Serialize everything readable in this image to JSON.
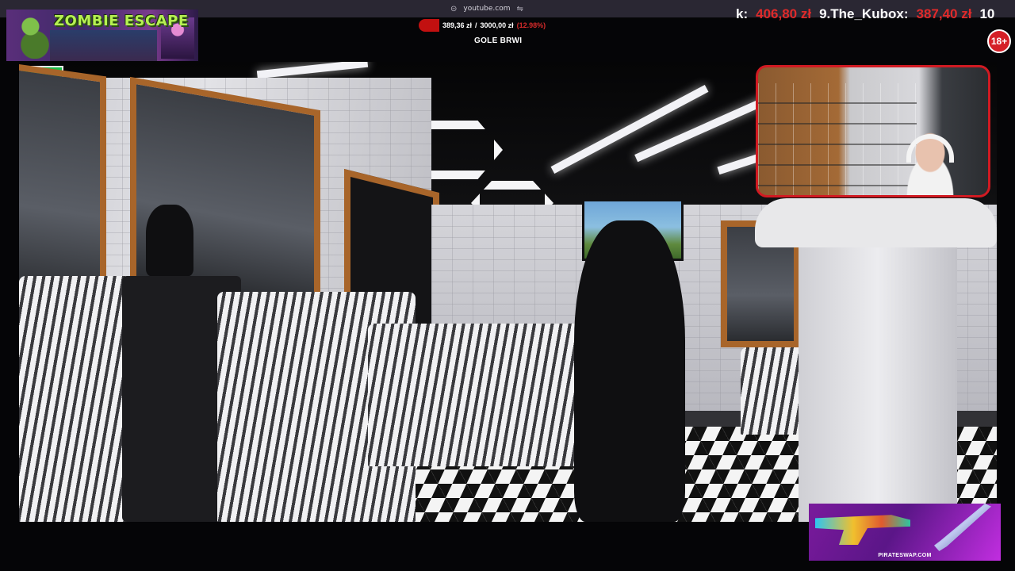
{
  "browser": {
    "url": "youtube.com",
    "left_icon": "link-icon",
    "right_icon": "settings-sliders-icon"
  },
  "ticker": {
    "segments": [
      {
        "name": "k:",
        "amount": "406,80 zł"
      },
      {
        "name": "9.The_Kubox:",
        "amount": "387,40 zł"
      },
      {
        "name": "10",
        "amount": ""
      }
    ]
  },
  "age_badge": "18+",
  "game_banner": {
    "title": "ZOMBIE ESCAPE"
  },
  "goal": {
    "current": "389,36 zł",
    "separator": "/",
    "target": "3000,00 zł",
    "percent": "(12.98%)",
    "progress": 0.1298,
    "label": "GOLE BRWI"
  },
  "ad": {
    "brand": "PIRATESWAP.COM"
  },
  "colors": {
    "accent_red": "#d11a22",
    "amount_red": "#e02a2a",
    "ad_purple": "#7a1a9c"
  }
}
